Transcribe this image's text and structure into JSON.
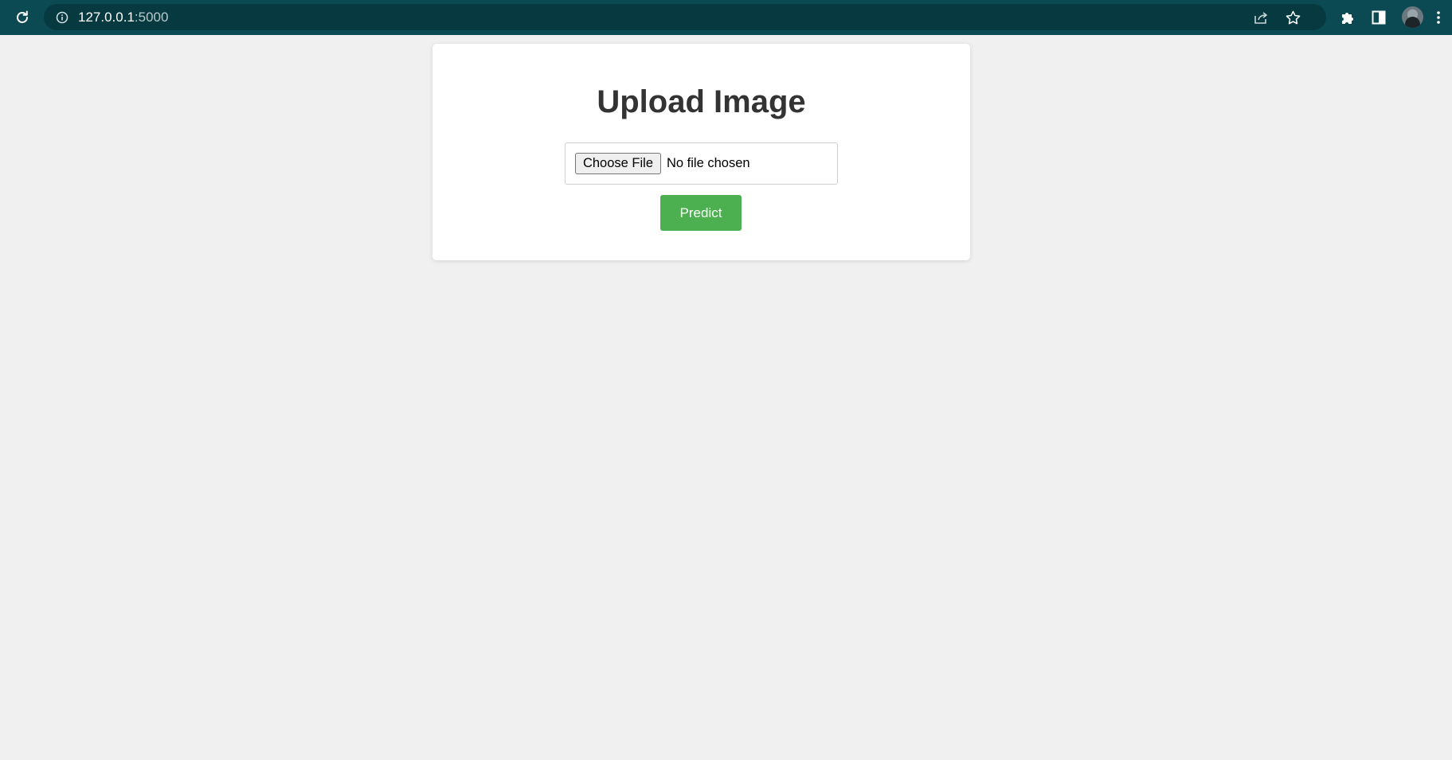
{
  "browser": {
    "url_host": "127.0.0.1",
    "url_port": ":5000",
    "icons": {
      "reload": "reload-icon",
      "site_info": "info-icon",
      "share": "share-icon",
      "bookmark": "star-icon",
      "extensions": "puzzle-icon",
      "side_panel": "side-panel-icon",
      "profile": "avatar",
      "menu": "kebab-menu-icon"
    },
    "colors": {
      "toolbar": "#0b4a52",
      "omnibox": "#063a40"
    }
  },
  "page": {
    "title": "Upload Image",
    "file_input": {
      "button_label": "Choose File",
      "status": "No file chosen"
    },
    "predict_label": "Predict",
    "colors": {
      "background": "#f0f0f0",
      "card": "#ffffff",
      "heading": "#333333",
      "predict_button": "#4caf50"
    }
  }
}
